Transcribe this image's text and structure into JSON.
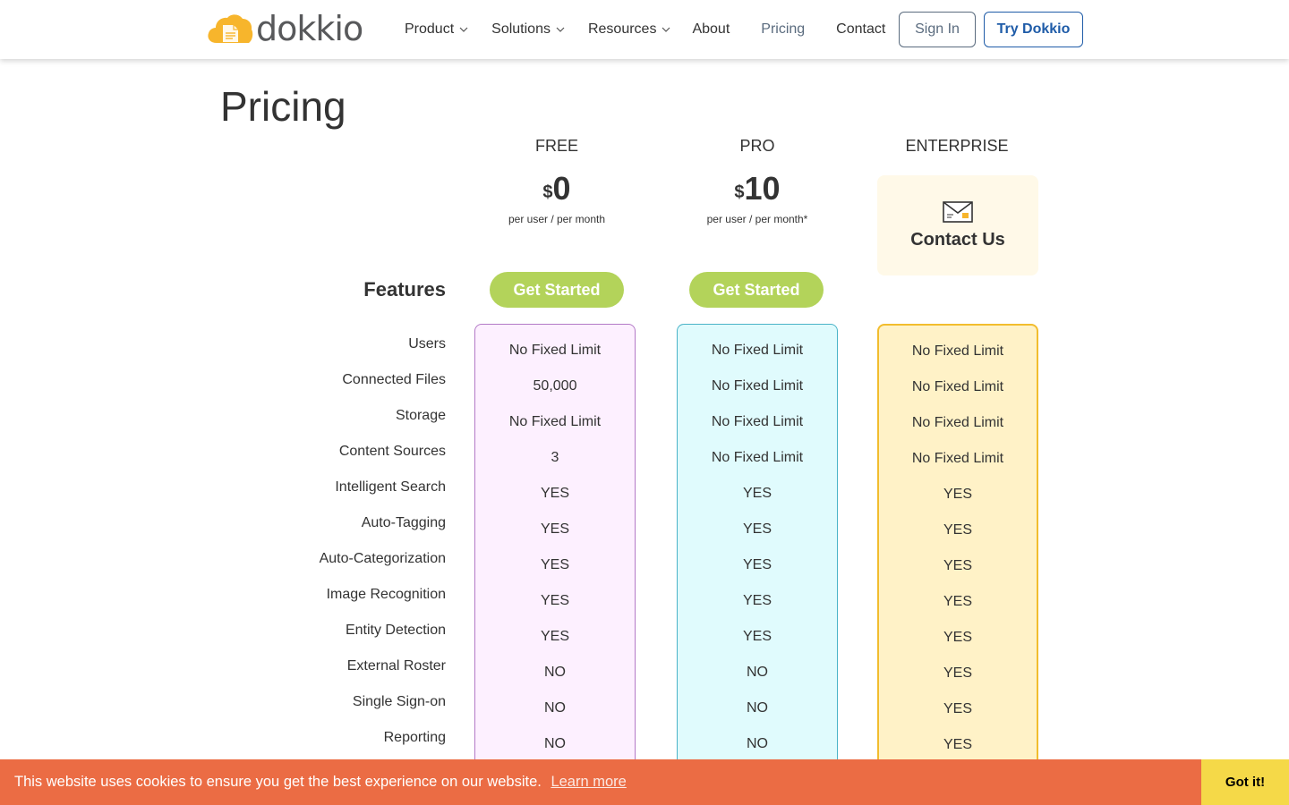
{
  "header": {
    "logo_text": "dokkio",
    "nav": [
      {
        "label": "Product",
        "dropdown": true
      },
      {
        "label": "Solutions",
        "dropdown": true
      },
      {
        "label": "Resources",
        "dropdown": true
      },
      {
        "label": "About",
        "dropdown": false
      },
      {
        "label": "Pricing",
        "dropdown": false,
        "active": true
      },
      {
        "label": "Contact",
        "dropdown": false
      }
    ],
    "sign_in": "Sign In",
    "try": "Try Dokkio"
  },
  "page_title": "Pricing",
  "features_title": "Features",
  "plans": {
    "free": {
      "name": "FREE",
      "currency": "$",
      "amount": "0",
      "per": "per user / per  month",
      "cta": "Get Started"
    },
    "pro": {
      "name": "PRO",
      "currency": "$",
      "amount": "10",
      "per": "per user / per  month*",
      "cta": "Get Started"
    },
    "enterprise": {
      "name": "ENTERPRISE",
      "contact": "Contact Us"
    }
  },
  "features": [
    "Users",
    "Connected Files",
    "Storage",
    "Content Sources",
    "Intelligent Search",
    "Auto-Tagging",
    "Auto-Categorization",
    "Image Recognition",
    "Entity Detection",
    "External Roster",
    "Single Sign-on",
    "Reporting"
  ],
  "values": {
    "free": [
      "No Fixed Limit",
      "50,000",
      "No Fixed Limit",
      "3",
      "YES",
      "YES",
      "YES",
      "YES",
      "YES",
      "NO",
      "NO",
      "NO"
    ],
    "pro": [
      "No Fixed Limit",
      "No Fixed Limit",
      "No Fixed Limit",
      "No Fixed Limit",
      "YES",
      "YES",
      "YES",
      "YES",
      "YES",
      "NO",
      "NO",
      "NO"
    ],
    "enterprise": [
      "No Fixed Limit",
      "No Fixed Limit",
      "No Fixed Limit",
      "No Fixed Limit",
      "YES",
      "YES",
      "YES",
      "YES",
      "YES",
      "YES",
      "YES",
      "YES"
    ]
  },
  "cookie": {
    "message": "This website uses cookies to ensure you get the best experience on our website.",
    "learn_more": "Learn more",
    "button": "Got it!"
  },
  "colors": {
    "brand_yellow": "#f7b52c",
    "cta_green": "#b3d35a",
    "cookie_bg": "#eb6c44",
    "cookie_button": "#f5d948",
    "try_blue": "#1f5ca8"
  }
}
